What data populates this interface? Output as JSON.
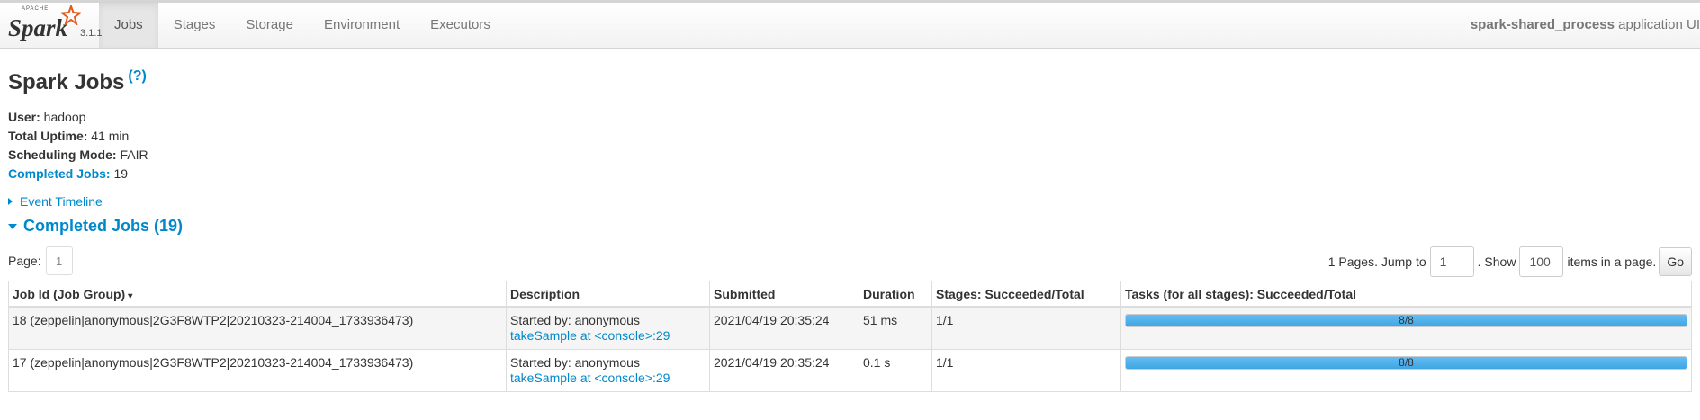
{
  "navbar": {
    "brand_apache": "APACHE",
    "brand_word": "Spark",
    "version": "3.1.1",
    "tabs": [
      {
        "label": "Jobs",
        "active": true
      },
      {
        "label": "Stages",
        "active": false
      },
      {
        "label": "Storage",
        "active": false
      },
      {
        "label": "Environment",
        "active": false
      },
      {
        "label": "Executors",
        "active": false
      }
    ],
    "app_name": "spark-shared_process",
    "app_suffix": " application UI"
  },
  "page": {
    "title": "Spark Jobs",
    "help": "(?)"
  },
  "summary": {
    "user_label": "User:",
    "user_value": " hadoop",
    "uptime_label": "Total Uptime:",
    "uptime_value": " 41 min",
    "mode_label": "Scheduling Mode:",
    "mode_value": " FAIR",
    "completed_label": "Completed Jobs:",
    "completed_value": " 19"
  },
  "event_timeline": "Event Timeline",
  "completed_section": "Completed Jobs (19)",
  "pager": {
    "page_label": "Page:",
    "current_page": "1",
    "pages_text": "1 Pages. Jump to",
    "jump_value": "1",
    "show_text": ". Show",
    "show_value": "100",
    "items_text": "items in a page.",
    "go": "Go"
  },
  "table": {
    "headers": {
      "job_id": "Job Id (Job Group)",
      "sort_indicator": "▾",
      "description": "Description",
      "submitted": "Submitted",
      "duration": "Duration",
      "stages": "Stages: Succeeded/Total",
      "tasks": "Tasks (for all stages): Succeeded/Total"
    },
    "rows": [
      {
        "job_id": "18 (zeppelin|anonymous|2G3F8WTP2|20210323-214004_1733936473)",
        "started_by": "Started by: anonymous",
        "desc_link": "takeSample at <console>:29",
        "submitted": "2021/04/19 20:35:24",
        "duration": "51 ms",
        "stages": "1/1",
        "tasks": "8/8",
        "tasks_progress": 1.0
      },
      {
        "job_id": "17 (zeppelin|anonymous|2G3F8WTP2|20210323-214004_1733936473)",
        "started_by": "Started by: anonymous",
        "desc_link": "takeSample at <console>:29",
        "submitted": "2021/04/19 20:35:24",
        "duration": "0.1 s",
        "stages": "1/1",
        "tasks": "8/8",
        "tasks_progress": 1.0
      }
    ]
  },
  "colors": {
    "link": "#0088cc",
    "progress": "#3ea6e3",
    "spark_star": "#e25a1c"
  }
}
